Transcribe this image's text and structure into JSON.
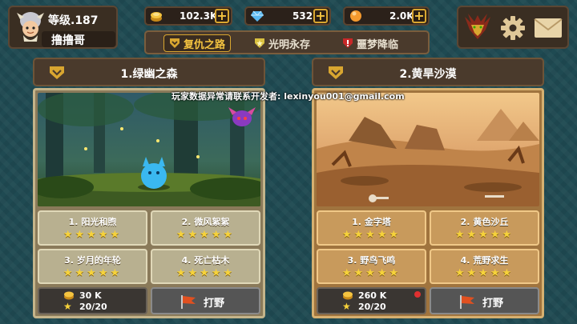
{
  "player": {
    "level_text": "等级.187",
    "name": "撸撸哥"
  },
  "currencies": [
    {
      "name": "gold",
      "value": "102.3K",
      "color": "#f5b82e"
    },
    {
      "name": "diamond",
      "value": "532",
      "color": "#5ab8f0"
    },
    {
      "name": "orb",
      "value": "2.0K",
      "color": "#f59a2e"
    }
  ],
  "tabs": [
    {
      "label": "复仇之路",
      "active": true
    },
    {
      "label": "光明永存",
      "active": false
    },
    {
      "label": "噩梦降临",
      "active": false
    }
  ],
  "notice": "玩家数据异常请联系开发者: lexinyou001@gmail.com",
  "regions": [
    {
      "title": "1.绿幽之森",
      "stages": [
        {
          "label": "1. 阳光和煦",
          "stars": "★★★★★"
        },
        {
          "label": "2. 微风絮絮",
          "stars": "★★★★★"
        },
        {
          "label": "3. 岁月的年轮",
          "stars": "★★★★★"
        },
        {
          "label": "4. 死亡枯木",
          "stars": "★★★★★"
        }
      ],
      "cost": "30 K",
      "stamina": "20/20",
      "hunt_label": "打野"
    },
    {
      "title": "2.黄旱沙漠",
      "stages": [
        {
          "label": "1. 金字塔",
          "stars": "★★★★★"
        },
        {
          "label": "2. 黄色沙丘",
          "stars": "★★★★★"
        },
        {
          "label": "3. 野鸟飞鸣",
          "stars": "★★★★★"
        },
        {
          "label": "4. 荒野求生",
          "stars": "★★★★★"
        }
      ],
      "cost": "260 K",
      "stamina": "20/20",
      "hunt_label": "打野"
    }
  ]
}
